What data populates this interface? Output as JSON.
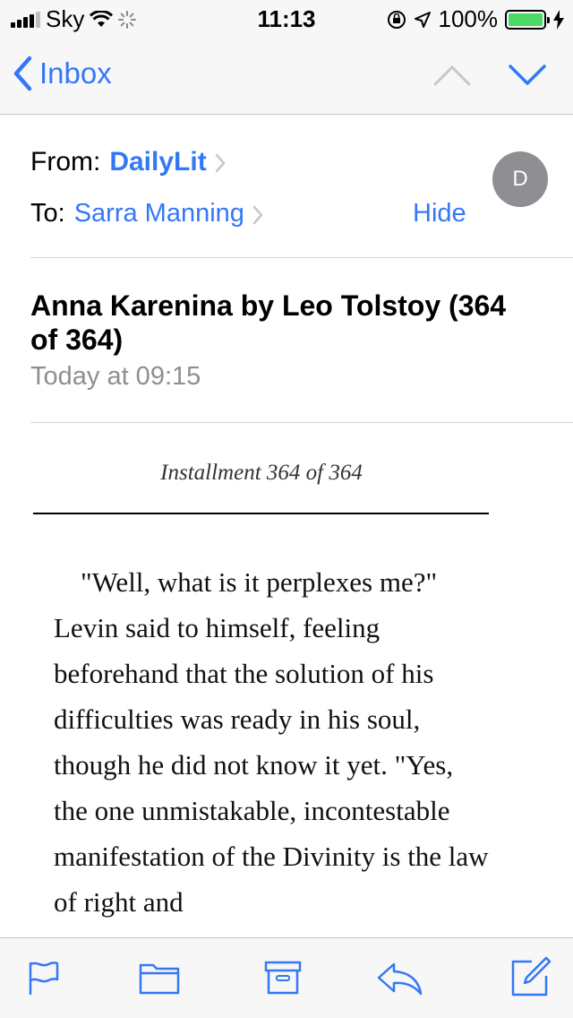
{
  "status_bar": {
    "carrier": "Sky",
    "time": "11:13",
    "battery": "100%",
    "battery_level": 1.0
  },
  "nav": {
    "back_label": "Inbox",
    "up_icon": "chevron-up-icon",
    "down_icon": "chevron-down-icon"
  },
  "header": {
    "from_label": "From:",
    "from_name": "DailyLit",
    "to_label": "To:",
    "to_name": "Sarra Manning",
    "hide_label": "Hide",
    "avatar_initial": "D"
  },
  "message": {
    "subject": "Anna Karenina by Leo Tolstoy (364 of 364)",
    "date": "Today at 09:15",
    "installment": "Installment 364 of 364",
    "body": "\"Well, what is it perplexes me?\" Levin said to himself, feeling beforehand that the solution of his difficulties was ready in his soul, though he did not know it yet. \"Yes, the one unmistakable, incontestable manifestation of the Divinity is the law of right and"
  },
  "toolbar": {
    "icons": [
      "flag-icon",
      "folder-icon",
      "archive-icon",
      "reply-icon",
      "compose-icon"
    ]
  },
  "colors": {
    "accent": "#3478f6",
    "bar_background": "#f7f7f7",
    "avatar": "#8e8e93",
    "battery": "#4cd964"
  }
}
